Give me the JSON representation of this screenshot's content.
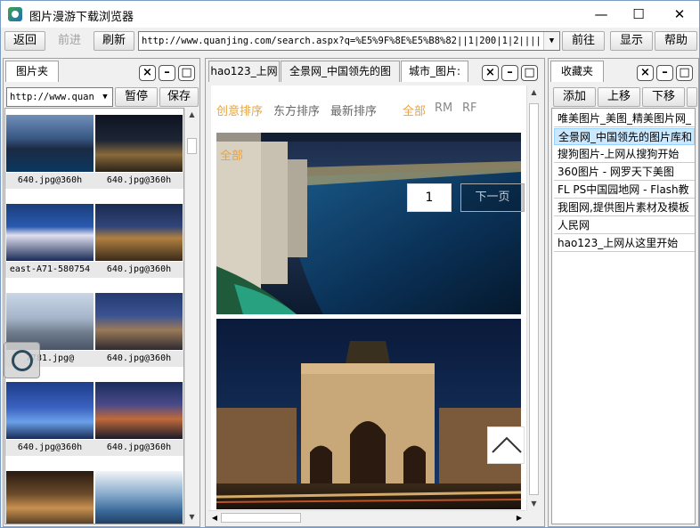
{
  "window": {
    "title": "图片漫游下载浏览器"
  },
  "toolbar": {
    "back": "返回",
    "forward": "前进",
    "refresh": "刷新",
    "url": "http://www.quanjing.com/search.aspx?q=%E5%9F%8E%E5%B8%82||1|200|1|2||||",
    "go": "前往",
    "show": "显示",
    "help": "帮助"
  },
  "left_pane": {
    "tab": "图片夹",
    "combo_value": "http://www.quan",
    "pause": "暂停",
    "save": "保存",
    "thumbs": [
      {
        "caption": "640.jpg@360h"
      },
      {
        "caption": "640.jpg@360h"
      },
      {
        "caption": "east-A71-580754"
      },
      {
        "caption": "640.jpg@360h"
      },
      {
        "caption": "7781.jpg@"
      },
      {
        "caption": "640.jpg@360h"
      },
      {
        "caption": "640.jpg@360h"
      },
      {
        "caption": "640.jpg@360h"
      },
      {
        "caption": ""
      },
      {
        "caption": ""
      }
    ]
  },
  "center_pane": {
    "tabs": [
      {
        "label": "hao123_上网"
      },
      {
        "label": "全景网_中国领先的图"
      },
      {
        "label": "城市_图片:"
      }
    ],
    "filters": {
      "creative": "创意排序",
      "oriental": "东方排序",
      "latest": "最新排序",
      "all": "全部",
      "rm": "RM",
      "rf": "RF"
    },
    "overlay_all": "全部",
    "page_number": "1",
    "next_page": "下一页"
  },
  "right_pane": {
    "tab": "收藏夹",
    "add": "添加",
    "up": "上移",
    "down": "下移",
    "favorites": [
      "唯美图片_美图_精美图片网_",
      "全景网_中国领先的图片库和",
      "搜狗图片-上网从搜狗开始",
      "360图片 - 网罗天下美图",
      "FL PS中国园地网 - Flash教",
      "我图网,提供图片素材及模板",
      "人民网",
      "hao123_上网从这里开始"
    ],
    "selected_index": 1
  },
  "colors": {
    "accent_orange": "#e8a33d",
    "selected_bg": "#cce8ff"
  }
}
